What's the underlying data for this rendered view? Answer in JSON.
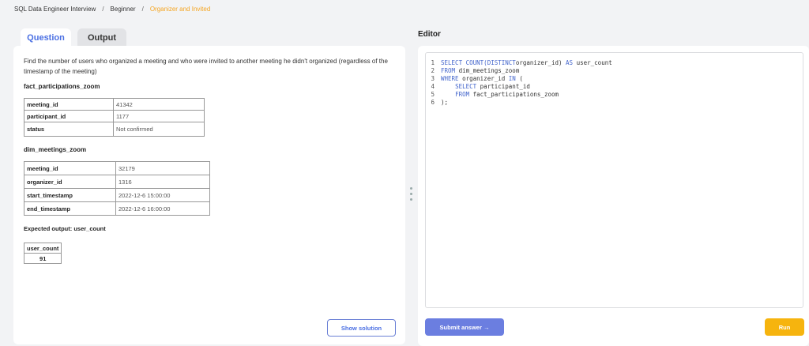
{
  "breadcrumb": [
    "SQL Data Engineer Interview",
    "Beginner",
    "Organizer and Invited"
  ],
  "tabs": {
    "question": "Question",
    "output": "Output"
  },
  "question": {
    "text": "Find the number of users who organized a meeting and who were invited to another meeting he didn't organized (regardless of the timestamp of the meeting)",
    "table1": {
      "name": "fact_participations_zoom",
      "rows": [
        [
          "meeting_id",
          "41342"
        ],
        [
          "participant_id",
          "1177"
        ],
        [
          "status",
          "Not confirmed"
        ]
      ]
    },
    "table2": {
      "name": "dim_meetings_zoom",
      "rows": [
        [
          "meeting_id",
          "32179"
        ],
        [
          "organizer_id",
          "1316"
        ],
        [
          "start_timestamp",
          "2022-12-6 15:00:00"
        ],
        [
          "end_timestamp",
          "2022-12-6 16:00:00"
        ]
      ]
    },
    "expected_label": "Expected output: user_count",
    "output_header": "user_count",
    "output_value": "91",
    "show_solution": "Show solution"
  },
  "editor": {
    "title": "Editor",
    "lines": [
      {
        "n": "1",
        "parts": [
          [
            "kw",
            "SELECT COUNT(DISTINCT"
          ],
          [
            "",
            "organizer_id) "
          ],
          [
            "kw",
            "AS"
          ],
          [
            "",
            " user_count"
          ]
        ]
      },
      {
        "n": "2",
        "parts": [
          [
            "kw",
            "FROM"
          ],
          [
            "",
            " dim_meetings_zoom"
          ]
        ]
      },
      {
        "n": "3",
        "parts": [
          [
            "kw",
            "WHERE"
          ],
          [
            "",
            " organizer_id "
          ],
          [
            "kw",
            "IN"
          ],
          [
            "",
            " ("
          ]
        ]
      },
      {
        "n": "4",
        "parts": [
          [
            "",
            "    "
          ],
          [
            "kw",
            "SELECT"
          ],
          [
            "",
            " participant_id"
          ]
        ]
      },
      {
        "n": "5",
        "parts": [
          [
            "",
            "    "
          ],
          [
            "kw",
            "FROM"
          ],
          [
            "",
            " fact_participations_zoom"
          ]
        ]
      },
      {
        "n": "6",
        "parts": [
          [
            "",
            ");"
          ]
        ]
      }
    ],
    "submit": "Submit answer →",
    "run": "Run"
  }
}
